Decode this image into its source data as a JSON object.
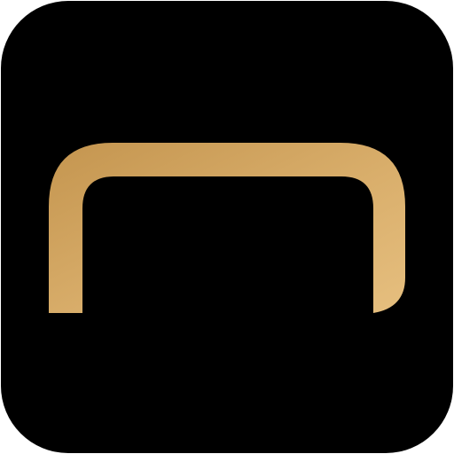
{
  "icon": {
    "name": "gold-arch-icon",
    "background_color": "#000000",
    "symbol_gradient": [
      "#c4954f",
      "#d9ae6b",
      "#e6bf7f"
    ]
  }
}
